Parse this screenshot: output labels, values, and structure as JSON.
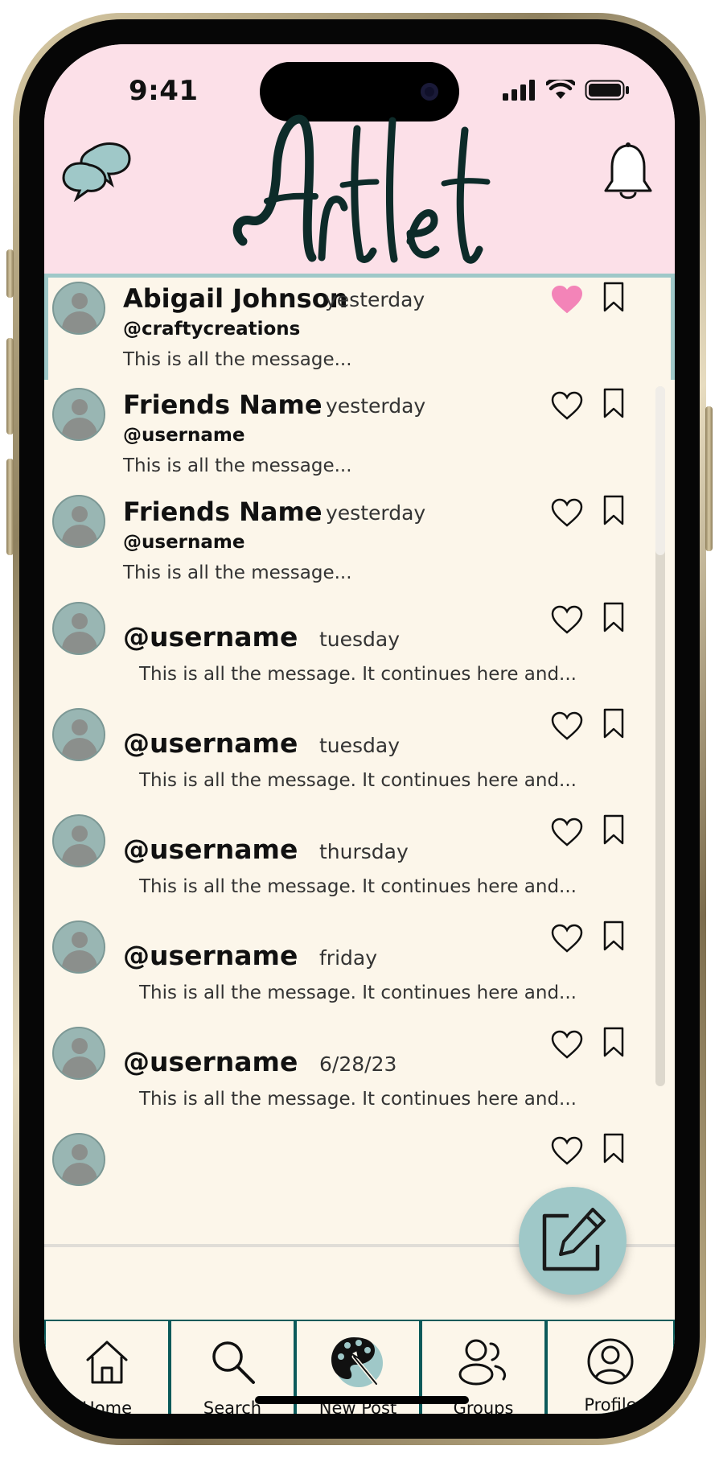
{
  "status_bar": {
    "time": "9:41"
  },
  "header": {
    "logo_text": "Artlet"
  },
  "messages": [
    {
      "name": "Abigail Johnson",
      "time": "yesterday",
      "handle": "@craftycreations",
      "text": "This is all the message...",
      "liked": true,
      "selected": true
    },
    {
      "name": "Friends Name",
      "time": "yesterday",
      "handle": "@username",
      "text": "This is all the message...",
      "liked": false
    },
    {
      "name": "Friends Name",
      "time": "yesterday",
      "handle": "@username",
      "text": "This is all the message...",
      "liked": false
    },
    {
      "name": "@username",
      "time": "tuesday",
      "text": "This is all the message. It continues here and...",
      "liked": false
    },
    {
      "name": "@username",
      "time": "tuesday",
      "text": "This is all the message. It continues here and...",
      "liked": false
    },
    {
      "name": "@username",
      "time": "thursday",
      "text": "This is all the message. It continues here and...",
      "liked": false
    },
    {
      "name": "@username",
      "time": "friday",
      "text": "This is all the message. It continues here and...",
      "liked": false
    },
    {
      "name": "@username",
      "time": "6/28/23",
      "text": "This is all the message. It continues here and...",
      "liked": false
    }
  ],
  "tabs": [
    {
      "label": "Home",
      "icon": "home-icon"
    },
    {
      "label": "Search",
      "icon": "search-icon"
    },
    {
      "label": "New Post",
      "icon": "palette-icon"
    },
    {
      "label": "Groups",
      "icon": "groups-icon"
    },
    {
      "label": "Profile",
      "icon": "profile-icon"
    }
  ],
  "colors": {
    "header_bg": "#fce0e8",
    "content_bg": "#fcf6ea",
    "accent_teal": "#9fc8c8",
    "tabbar_teal": "#0b5a5a",
    "heart_pink": "#f384b8"
  }
}
